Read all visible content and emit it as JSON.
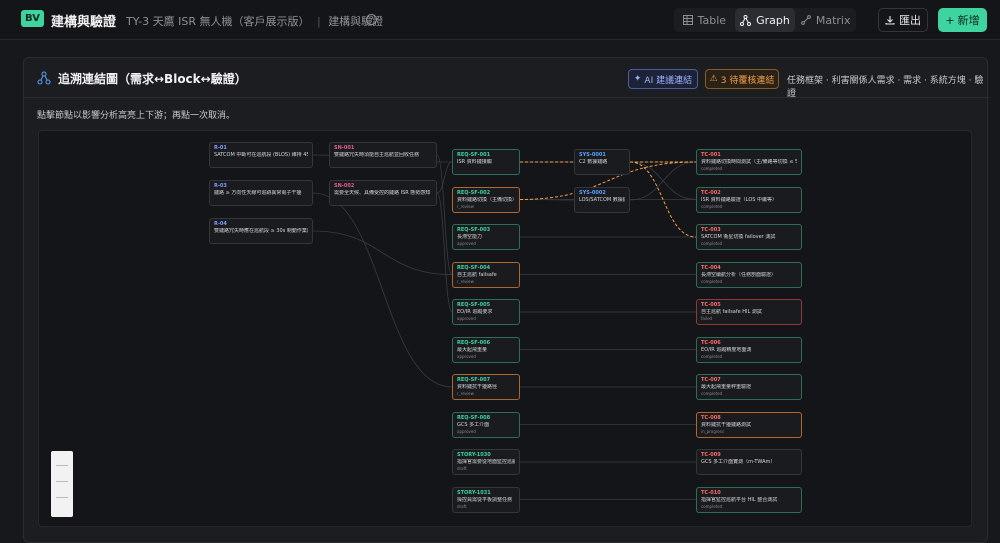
{
  "header": {
    "logo": "BV",
    "title": "建構與驗證",
    "subtitle": "TY-3 天鷹 ISR 無人機（客戶展示版）",
    "breadcrumb": "建構與驗證",
    "help_glyph": "?",
    "tabs": [
      {
        "label": "Table",
        "icon": "table-icon",
        "active": false
      },
      {
        "label": "Graph",
        "icon": "graph-icon",
        "active": true
      },
      {
        "label": "Matrix",
        "icon": "matrix-icon",
        "active": false
      }
    ],
    "export_label": "匯出",
    "new_label": "新增"
  },
  "panel": {
    "title": "追溯連結圖（需求↔Block↔驗證）",
    "ai_label": "AI 建議連結",
    "pending_label": "3 待覆核連結",
    "legend": "任務框架 · 利害關係人需求 · 需求 · 系統方塊 · 驗證",
    "hint": "點擊節點以影響分析高亮上下游；再點一次取消。"
  },
  "colors": {
    "accent": "#3fd3a0",
    "ai": "#9bb2ff",
    "pending": "#f3a048"
  },
  "graph": {
    "columns": [
      {
        "key": "mission",
        "nodes": [
          {
            "id": "R-01",
            "label": "SATCOM 中斷可在巡航段 (BLOS) 維持 45 M...",
            "status": "",
            "color": "dark",
            "idcolor": "#7f9cff"
          },
          {
            "id": "R-03",
            "label": "鏈路 ≥ 方向性天線可追跡異常電子干擾",
            "status": "",
            "color": "dark",
            "idcolor": "#7f9cff"
          },
          {
            "id": "R-04",
            "label": "雙鏈路冗失時應在巡航段 ≥ 30s 制動作業防...",
            "status": "",
            "color": "dark",
            "idcolor": "#7f9cff"
          }
        ]
      },
      {
        "key": "stakeholder",
        "nodes": [
          {
            "id": "SN-001",
            "label": "雙鏈路冗失時須能自主巡航並回收任務",
            "status": "",
            "color": "dark",
            "idcolor": "#e05d8a"
          },
          {
            "id": "SN-002",
            "label": "需要全天候、具備受控的鏈路 ISR 態勢感知",
            "status": "",
            "color": "dark",
            "idcolor": "#e05d8a"
          }
        ]
      },
      {
        "key": "requirement",
        "nodes": [
          {
            "id": "REQ-SF-001",
            "label": "ISR 資料鏈接觸",
            "status": "",
            "color": "green",
            "idcolor": "#3fd3a0"
          },
          {
            "id": "REQ-SF-002",
            "label": "資料鏈路切換（主備切換）",
            "status": "r_review",
            "color": "orange",
            "idcolor": "#3fd3a0"
          },
          {
            "id": "REQ-SF-003",
            "label": "長滯空能力",
            "status": "approved",
            "color": "green",
            "idcolor": "#3fd3a0"
          },
          {
            "id": "REQ-SF-004",
            "label": "自主巡航 failsafe",
            "status": "r_review",
            "color": "orange",
            "idcolor": "#3fd3a0"
          },
          {
            "id": "REQ-SF-005",
            "label": "EO/IR 追蹤要求",
            "status": "approved",
            "color": "green",
            "idcolor": "#3fd3a0"
          },
          {
            "id": "REQ-SF-006",
            "label": "最大起飛重量",
            "status": "approved",
            "color": "green",
            "idcolor": "#3fd3a0"
          },
          {
            "id": "REQ-SF-007",
            "label": "資料鏈抗干擾路徑",
            "status": "r_review",
            "color": "orange",
            "idcolor": "#3fd3a0"
          },
          {
            "id": "REQ-SF-008",
            "label": "GCS 多工介面",
            "status": "approved",
            "color": "green",
            "idcolor": "#3fd3a0"
          },
          {
            "id": "STORY-1030",
            "label": "指揮官需要從地面監控巡航任務",
            "status": "draft",
            "color": "dark",
            "idcolor": "#3fd3a0"
          },
          {
            "id": "STORY-1031",
            "label": "操控員需從平板調整任務",
            "status": "draft",
            "color": "dark",
            "idcolor": "#3fd3a0"
          }
        ]
      },
      {
        "key": "block",
        "nodes": [
          {
            "id": "SYS-0001",
            "label": "C2 數據鏈路",
            "status": "",
            "color": "dark",
            "idcolor": "#5aa0ff"
          },
          {
            "id": "SYS-0002",
            "label": "LOS/SATCOM 數據鏈路",
            "status": "",
            "color": "dark",
            "idcolor": "#5aa0ff"
          }
        ]
      },
      {
        "key": "verification",
        "nodes": [
          {
            "id": "TC-001",
            "label": "資料鏈路切換時間測試（主/備路等切換 ≤ 500m...",
            "status": "completed",
            "color": "green",
            "idcolor": "#ff6b6b"
          },
          {
            "id": "TC-002",
            "label": "ISR 資料鏈路驗證（LOS 中繼等）",
            "status": "completed",
            "color": "green",
            "idcolor": "#ff6b6b"
          },
          {
            "id": "TC-003",
            "label": "SATCOM 衛星切換 failover 測試",
            "status": "completed",
            "color": "green",
            "idcolor": "#ff6b6b"
          },
          {
            "id": "TC-004",
            "label": "長滯空續航分析（任務剖面驗證）",
            "status": "completed",
            "color": "green",
            "idcolor": "#ff6b6b"
          },
          {
            "id": "TC-005",
            "label": "自主巡航 failsafe HIL 測試",
            "status": "failed",
            "color": "red",
            "idcolor": "#ff6b6b"
          },
          {
            "id": "TC-006",
            "label": "EO/IR 追蹤精度地面測",
            "status": "completed",
            "color": "green",
            "idcolor": "#ff6b6b"
          },
          {
            "id": "TC-007",
            "label": "最大起飛重量秤重驗證",
            "status": "completed",
            "color": "green",
            "idcolor": "#ff6b6b"
          },
          {
            "id": "TC-008",
            "label": "資料鏈抗干擾鏈路測試",
            "status": "in_progress",
            "color": "orange",
            "idcolor": "#ff6b6b"
          },
          {
            "id": "TC-009",
            "label": "GCS 多工介面實測（m-TWAm）",
            "status": "",
            "color": "dark",
            "idcolor": "#ff6b6b"
          },
          {
            "id": "TC-010",
            "label": "指揮官監控巡航平台 HIL 整合測試",
            "status": "completed",
            "color": "green",
            "idcolor": "#ff6b6b"
          }
        ]
      }
    ]
  }
}
